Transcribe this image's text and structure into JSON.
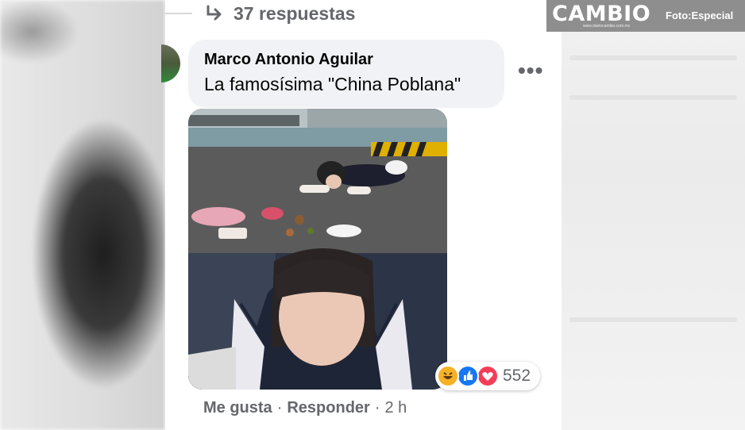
{
  "thread": {
    "replies_label": "37 respuestas"
  },
  "comment": {
    "author": "Marco Antonio Aguilar",
    "text": "La famosísima \"China Poblana\"",
    "more_label": "•••"
  },
  "reactions": {
    "icons": [
      "haha-icon",
      "like-icon",
      "love-icon"
    ],
    "count": "552"
  },
  "actions": {
    "like_label": "Me gusta",
    "separator": "·",
    "reply_label": "Responder",
    "time": "2 h"
  },
  "watermark": {
    "brand": "CAMBIO",
    "url": "www.diariocambio.com.mx",
    "credit": "Foto:Especial"
  },
  "colors": {
    "bubble": "#f0f2f5",
    "secondary_text": "#65676b",
    "primary_text": "#050505",
    "brand_bar": "#8e8e8e"
  }
}
